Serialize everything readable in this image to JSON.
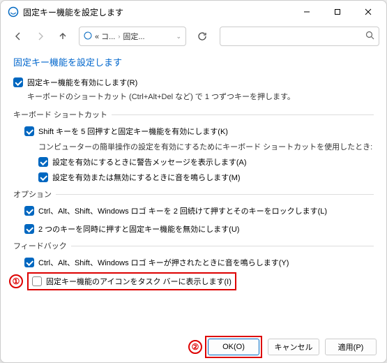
{
  "window": {
    "title": "固定キー機能を設定します"
  },
  "address": {
    "seg1": "« コ...",
    "seg2": "固定..."
  },
  "page": {
    "title": "固定キー機能を設定します",
    "enable": {
      "label": "固定キー機能を有効にします(R)",
      "checked": true
    },
    "enable_desc": "キーボードのショートカット (Ctrl+Alt+Del など) で 1 つずつキーを押します。"
  },
  "groups": {
    "shortcut": {
      "title": "キーボード ショートカット",
      "item1": {
        "label": "Shift キーを 5 回押すと固定キー機能を有効にします(K)",
        "checked": true
      },
      "item1_desc": "コンピューターの簡単操作の設定を有効にするためにキーボード ショートカットを使用したとき:",
      "item2": {
        "label": "設定を有効にするときに警告メッセージを表示します(A)",
        "checked": true
      },
      "item3": {
        "label": "設定を有効または無効にするときに音を鳴らします(M)",
        "checked": true
      }
    },
    "option": {
      "title": "オプション",
      "item1": {
        "label": "Ctrl、Alt、Shift、Windows ロゴ キーを 2 回続けて押すとそのキーをロックします(L)",
        "checked": true
      },
      "item2": {
        "label": "2 つのキーを同時に押すと固定キー機能を無効にします(U)",
        "checked": true
      }
    },
    "feedback": {
      "title": "フィードバック",
      "item1": {
        "label": "Ctrl、Alt、Shift、Windows ロゴ キーが押されたときに音を鳴らします(Y)",
        "checked": true
      },
      "item2": {
        "label": "固定キー機能のアイコンをタスク バーに表示します(I)",
        "checked": false
      }
    }
  },
  "callouts": {
    "one": "①",
    "two": "②"
  },
  "buttons": {
    "ok": "OK(O)",
    "cancel": "キャンセル",
    "apply": "適用(P)"
  }
}
